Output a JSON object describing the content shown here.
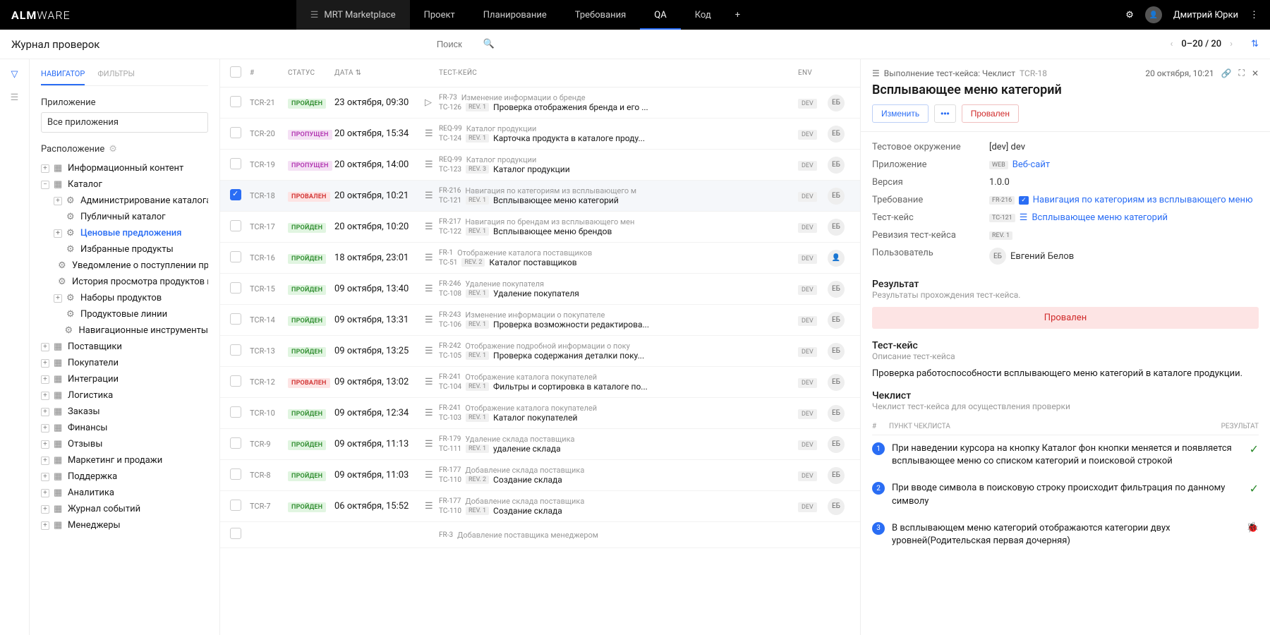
{
  "logo": {
    "bold": "ALM",
    "thin": "WARE"
  },
  "nav": [
    {
      "label": "MRT Marketplace",
      "project": true
    },
    {
      "label": "Проект"
    },
    {
      "label": "Планирование"
    },
    {
      "label": "Требования"
    },
    {
      "label": "QA",
      "active": true
    },
    {
      "label": "Код"
    }
  ],
  "user": {
    "name": "Дмитрий Юрки"
  },
  "page_title": "Журнал проверок",
  "search_placeholder": "Поиск",
  "pager": {
    "range": "0–20 / 20"
  },
  "sidebar": {
    "tabs": {
      "nav": "НАВИГАТОР",
      "filters": "ФИЛЬТРЫ"
    },
    "app_label": "Приложение",
    "app_value": "Все приложения",
    "location_label": "Расположение",
    "tree": [
      {
        "label": "Информационный контент",
        "toggle": "+",
        "icon": "layout"
      },
      {
        "label": "Каталог",
        "toggle": "−",
        "icon": "layout",
        "children": [
          {
            "label": "Администрирование каталога (PIM)",
            "toggle": "+",
            "icon": "gear"
          },
          {
            "label": "Публичный каталог",
            "icon": "gear"
          },
          {
            "label": "Ценовые предложения",
            "toggle": "+",
            "icon": "gear",
            "selected": true
          },
          {
            "label": "Избранные продукты",
            "icon": "gear"
          },
          {
            "label": "Уведомление о поступлении продукта",
            "icon": "gear"
          },
          {
            "label": "История просмотра продуктов поку...",
            "icon": "gear"
          },
          {
            "label": "Наборы продуктов",
            "toggle": "+",
            "icon": "gear"
          },
          {
            "label": "Продуктовые линии",
            "icon": "gear"
          },
          {
            "label": "Навигационные инструменты",
            "icon": "gear"
          }
        ]
      },
      {
        "label": "Поставщики",
        "toggle": "+",
        "icon": "layout"
      },
      {
        "label": "Покупатели",
        "toggle": "+",
        "icon": "layout"
      },
      {
        "label": "Интеграции",
        "toggle": "+",
        "icon": "layout"
      },
      {
        "label": "Логистика",
        "toggle": "+",
        "icon": "layout"
      },
      {
        "label": "Заказы",
        "toggle": "+",
        "icon": "layout"
      },
      {
        "label": "Финансы",
        "toggle": "+",
        "icon": "layout"
      },
      {
        "label": "Отзывы",
        "toggle": "+",
        "icon": "layout"
      },
      {
        "label": "Маркетинг и продажи",
        "toggle": "+",
        "icon": "layout"
      },
      {
        "label": "Поддержка",
        "toggle": "+",
        "icon": "layout"
      },
      {
        "label": "Аналитика",
        "toggle": "+",
        "icon": "layout"
      },
      {
        "label": "Журнал событий",
        "toggle": "+",
        "icon": "layout"
      },
      {
        "label": "Менеджеры",
        "toggle": "+",
        "icon": "layout"
      }
    ]
  },
  "table": {
    "headers": {
      "id": "#",
      "status": "СТАТУС",
      "date": "ДАТА",
      "tc": "ТЕСТ-КЕЙС",
      "env": "ENV"
    },
    "rows": [
      {
        "id": "TCR-21",
        "status": "ПРОЙДЕН",
        "status_cls": "pass",
        "date": "23 октября, 09:30",
        "type": "play",
        "fr": "FR-73",
        "fr_title": "Изменение информации о бренде",
        "tc": "TC-126",
        "rev": "REV. 1",
        "tc_title": "Проверка отображения бренда и его ...",
        "env": "DEV",
        "user": "ЕБ"
      },
      {
        "id": "TCR-20",
        "status": "ПРОПУЩЕН",
        "status_cls": "skip",
        "date": "20 октября, 15:34",
        "type": "list",
        "fr": "REQ-99",
        "fr_title": "Каталог продукции",
        "tc": "TC-124",
        "rev": "REV. 1",
        "tc_title": "Карточка продукта в каталоге проду...",
        "env": "DEV",
        "user": "ЕБ"
      },
      {
        "id": "TCR-19",
        "status": "ПРОПУЩЕН",
        "status_cls": "skip",
        "date": "20 октября, 14:00",
        "type": "list",
        "fr": "REQ-99",
        "fr_title": "Каталог продукции",
        "tc": "TC-123",
        "rev": "REV. 3",
        "tc_title": "Каталог продукции",
        "env": "DEV",
        "user": "ЕБ"
      },
      {
        "id": "TCR-18",
        "status": "ПРОВАЛЕН",
        "status_cls": "fail",
        "date": "20 октября, 10:21",
        "type": "list",
        "fr": "FR-216",
        "fr_title": "Навигация по категориям из всплывающего м",
        "tc": "TC-121",
        "rev": "REV. 1",
        "tc_title": "Всплывающее меню категорий",
        "env": "DEV",
        "user": "ЕБ",
        "selected": true,
        "checked": true
      },
      {
        "id": "TCR-17",
        "status": "ПРОЙДЕН",
        "status_cls": "pass",
        "date": "20 октября, 10:20",
        "type": "list",
        "fr": "FR-217",
        "fr_title": "Навигация по брендам из всплывающего мен",
        "tc": "TC-122",
        "rev": "REV. 1",
        "tc_title": "Всплывающее меню брендов",
        "env": "DEV",
        "user": "ЕБ"
      },
      {
        "id": "TCR-16",
        "status": "ПРОЙДЕН",
        "status_cls": "pass",
        "date": "18 октября, 23:01",
        "type": "list",
        "fr": "FR-1",
        "fr_title": "Отображение каталога поставщиков",
        "tc": "TC-51",
        "rev": "REV. 2",
        "tc_title": "Каталог поставщиков",
        "env": "DEV",
        "user": "avatar"
      },
      {
        "id": "TCR-15",
        "status": "ПРОЙДЕН",
        "status_cls": "pass",
        "date": "09 октября, 13:40",
        "type": "list",
        "fr": "FR-246",
        "fr_title": "Удаление покупателя",
        "tc": "TC-108",
        "rev": "REV. 1",
        "tc_title": "Удаление покупателя",
        "env": "DEV",
        "user": "ЕБ"
      },
      {
        "id": "TCR-14",
        "status": "ПРОЙДЕН",
        "status_cls": "pass",
        "date": "09 октября, 13:31",
        "type": "list",
        "fr": "FR-243",
        "fr_title": "Изменение информации о покупателе",
        "tc": "TC-106",
        "rev": "REV. 1",
        "tc_title": "Проверка возможности редактирова...",
        "env": "DEV",
        "user": "ЕБ"
      },
      {
        "id": "TCR-13",
        "status": "ПРОЙДЕН",
        "status_cls": "pass",
        "date": "09 октября, 13:25",
        "type": "list",
        "fr": "FR-242",
        "fr_title": "Отображение подробной информации о поку",
        "tc": "TC-105",
        "rev": "REV. 1",
        "tc_title": "Проверка содержания деталки поку...",
        "env": "DEV",
        "user": "ЕБ"
      },
      {
        "id": "TCR-12",
        "status": "ПРОВАЛЕН",
        "status_cls": "fail",
        "date": "09 октября, 13:02",
        "type": "list",
        "fr": "FR-241",
        "fr_title": "Отображение каталога покупателей",
        "tc": "TC-104",
        "rev": "REV. 1",
        "tc_title": "Фильтры и сортировка в каталоге по...",
        "env": "DEV",
        "user": "ЕБ"
      },
      {
        "id": "TCR-10",
        "status": "ПРОЙДЕН",
        "status_cls": "pass",
        "date": "09 октября, 12:34",
        "type": "list",
        "fr": "FR-241",
        "fr_title": "Отображение каталога покупателей",
        "tc": "TC-103",
        "rev": "REV. 1",
        "tc_title": "Каталог покупателей",
        "env": "DEV",
        "user": "ЕБ"
      },
      {
        "id": "TCR-9",
        "status": "ПРОЙДЕН",
        "status_cls": "pass",
        "date": "09 октября, 11:13",
        "type": "list",
        "fr": "FR-179",
        "fr_title": "Удаление склада поставщика",
        "tc": "TC-111",
        "rev": "REV. 1",
        "tc_title": "удаление склада",
        "env": "DEV",
        "user": "ЕБ"
      },
      {
        "id": "TCR-8",
        "status": "ПРОЙДЕН",
        "status_cls": "pass",
        "date": "09 октября, 11:03",
        "type": "list",
        "fr": "FR-177",
        "fr_title": "Добавление склада поставщика",
        "tc": "TC-110",
        "rev": "REV. 2",
        "tc_title": "Создание склада",
        "env": "DEV",
        "user": "ЕБ"
      },
      {
        "id": "TCR-7",
        "status": "ПРОЙДЕН",
        "status_cls": "pass",
        "date": "06 октября, 15:52",
        "type": "list",
        "fr": "FR-177",
        "fr_title": "Добавление склада поставщика",
        "tc": "TC-110",
        "rev": "REV. 1",
        "tc_title": "Создание склада",
        "env": "DEV",
        "user": "ЕБ"
      },
      {
        "id": "",
        "status": "",
        "status_cls": "",
        "date": "",
        "type": "",
        "fr": "FR-3",
        "fr_title": "Добавление поставщика менеджером",
        "tc": "",
        "rev": "",
        "tc_title": "",
        "env": "",
        "user": ""
      }
    ]
  },
  "detail": {
    "breadcrumb_prefix": "Выполнение тест-кейса: Чеклист",
    "breadcrumb_id": "TCR-18",
    "date": "20 октября, 10:21",
    "title": "Всплывающее меню категорий",
    "actions": {
      "edit": "Изменить",
      "fail": "Провален"
    },
    "props": {
      "env_l": "Тестовое окружение",
      "env_v": "[dev] dev",
      "app_l": "Приложение",
      "app_badge": "WEB",
      "app_v": "Веб-сайт",
      "ver_l": "Версия",
      "ver_v": "1.0.0",
      "req_l": "Требование",
      "req_id": "FR-216",
      "req_v": "Навигация по категориям из всплывающего меню",
      "tc_l": "Тест-кейс",
      "tc_id": "TC-121",
      "tc_v": "Всплывающее меню категорий",
      "rev_l": "Ревизия тест-кейса",
      "rev_v": "REV. 1",
      "user_l": "Пользователь",
      "user_badge": "ЕБ",
      "user_v": "Евгений Белов"
    },
    "result_h": "Результат",
    "result_sub": "Результаты прохождения тест-кейса.",
    "result_banner": "Провален",
    "tc_h": "Тест-кейс",
    "tc_sub": "Описание тест-кейса",
    "tc_desc": "Проверка работоспособности всплывающего меню категорий в каталоге продукции.",
    "checklist_h": "Чеклист",
    "checklist_sub": "Чеклист тест-кейса для осуществления проверки",
    "checklist_headers": {
      "num": "#",
      "text": "ПУНКТ ЧЕКЛИСТА",
      "res": "РЕЗУЛЬТАТ"
    },
    "checklist": [
      {
        "n": "1",
        "text": "При наведении курсора на кнопку Каталог фон кнопки меняется и появляется всплывающее меню со списком категорий и поисковой строкой",
        "ok": true
      },
      {
        "n": "2",
        "text": "При вводе символа в поисковую строку происходит фильтрация по данному символу",
        "ok": true
      },
      {
        "n": "3",
        "text": "В всплывающем меню категорий отображаются категории двух уровней(Родительская первая дочерняя)",
        "ok": false
      }
    ]
  }
}
